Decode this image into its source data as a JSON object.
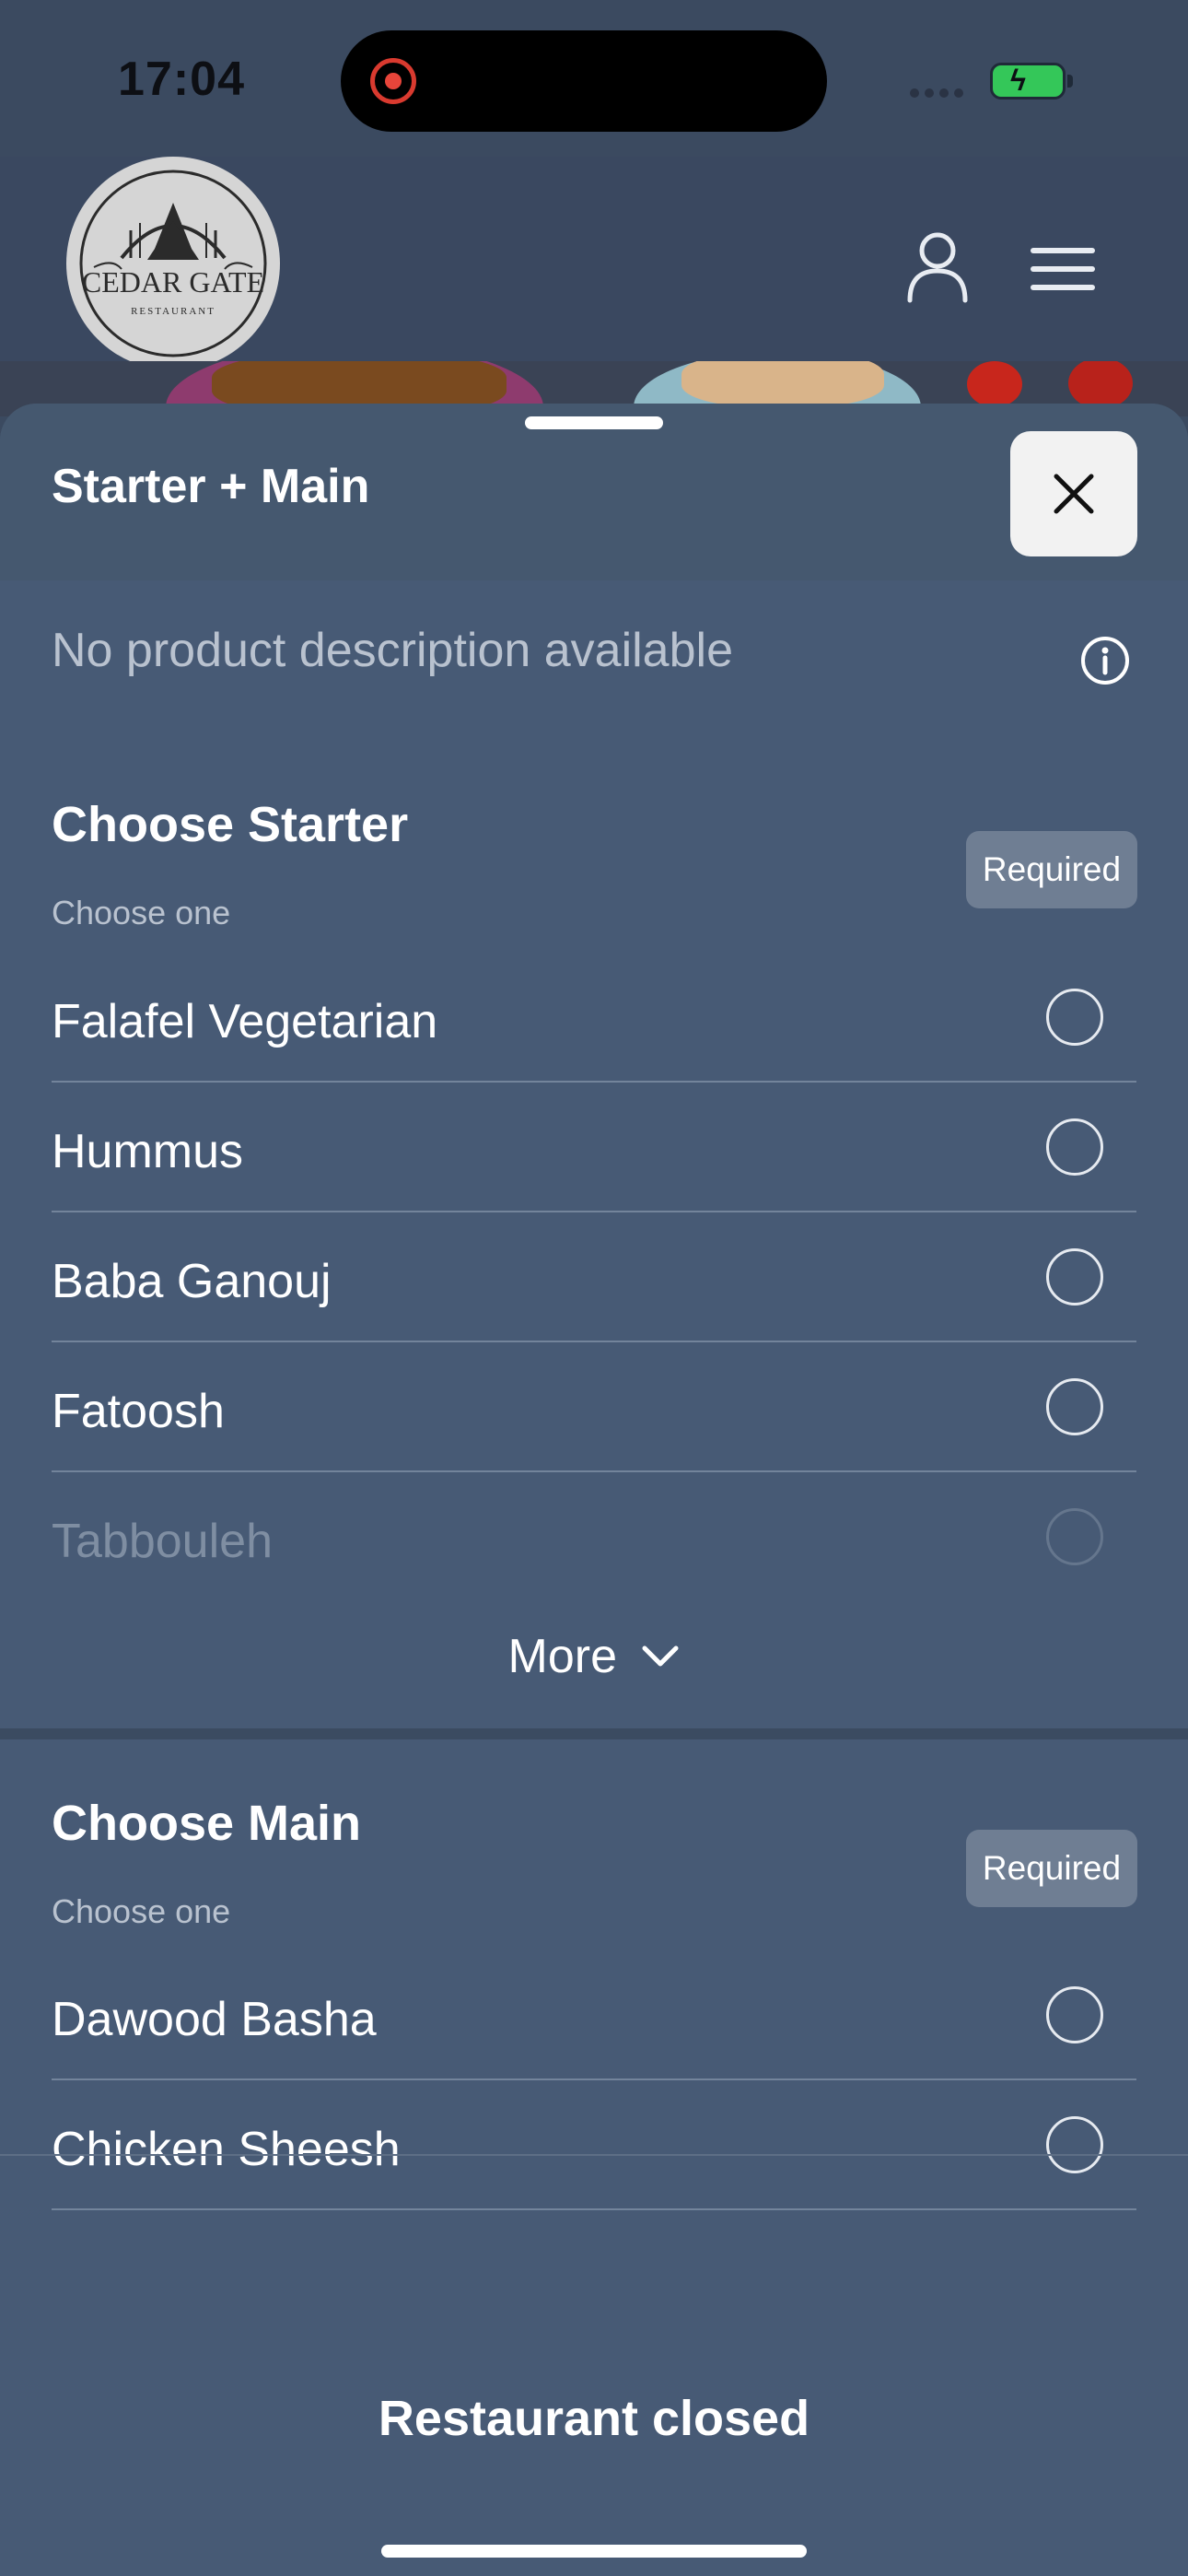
{
  "status_bar": {
    "time": "17:04"
  },
  "header": {
    "logo_text": "CEDAR GATE",
    "logo_subtext": "RESTAURANT"
  },
  "sheet": {
    "title": "Starter + Main",
    "description": "No product description available",
    "sections": [
      {
        "title": "Choose Starter",
        "subtitle": "Choose one",
        "badge": "Required",
        "options": [
          "Falafel Vegetarian",
          "Hummus",
          "Baba Ganouj",
          "Fatoosh",
          "Tabbouleh"
        ],
        "more_label": "More"
      },
      {
        "title": "Choose Main",
        "subtitle": "Choose one",
        "badge": "Required",
        "options": [
          "Dawood Basha",
          "Chicken Sheesh"
        ]
      }
    ],
    "footer_status": "Restaurant closed"
  },
  "colors": {
    "background": "#3b4a60",
    "sheet": "#475a75",
    "badge": "#6f7e93",
    "battery": "#34c759"
  }
}
